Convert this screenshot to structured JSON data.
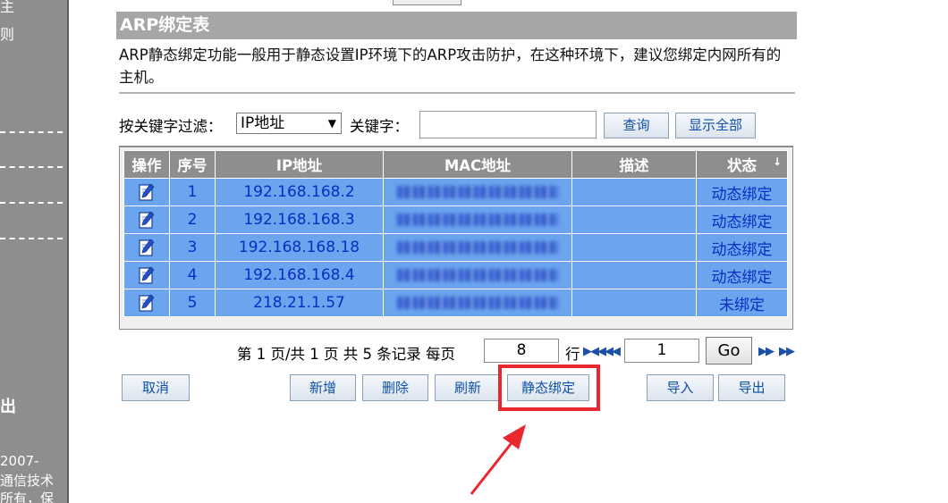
{
  "sidebar": {
    "fragments": [
      "主",
      "则"
    ],
    "logout_label": "出",
    "copyright_lines": [
      "2007-",
      "通信技术",
      "所有，保"
    ]
  },
  "panel": {
    "title": "ARP绑定表",
    "description": "ARP静态绑定功能一般用于静态设置IP环境下的ARP攻击防护，在这种环境下，建议您绑定内网所有的主机。"
  },
  "filter": {
    "label": "按关键字过滤：",
    "select_value": "IP地址",
    "keyword_label": "关键字：",
    "keyword_value": "",
    "query_label": "查询",
    "show_all_label": "显示全部"
  },
  "table": {
    "headers": [
      "操作",
      "序号",
      "IP地址",
      "MAC地址",
      "描述",
      "状态"
    ],
    "rows": [
      {
        "index": "1",
        "ip": "192.168.168.2",
        "desc": "",
        "status": "动态绑定"
      },
      {
        "index": "2",
        "ip": "192.168.168.3",
        "desc": "",
        "status": "动态绑定"
      },
      {
        "index": "3",
        "ip": "192.168.168.18",
        "desc": "",
        "status": "动态绑定"
      },
      {
        "index": "4",
        "ip": "192.168.168.4",
        "desc": "",
        "status": "动态绑定"
      },
      {
        "index": "5",
        "ip": "218.21.1.57",
        "desc": "",
        "status": "未绑定"
      }
    ]
  },
  "pagination": {
    "summary": "第 1 页/共 1 页 共 5 条记录 每页",
    "per_page": "8",
    "per_page_unit": "行",
    "current_page": "1",
    "go_label": "Go"
  },
  "actions": {
    "cancel": "取消",
    "add": "新增",
    "delete": "删除",
    "refresh": "刷新",
    "static_bind": "静态绑定",
    "import": "导入",
    "export": "导出"
  },
  "colors": {
    "accent_blue": "#6aa5ee",
    "header_gray": "#8e8e8e",
    "highlight_red": "#e8282e",
    "link_blue": "#0e4fa8"
  },
  "icons": {
    "edit": "edit-icon",
    "sort": "sort-arrow-icon",
    "first": "first-page-icon",
    "prev": "prev-page-icon",
    "next": "next-page-icon",
    "last": "last-page-icon",
    "annotation": "red-arrow-icon"
  }
}
